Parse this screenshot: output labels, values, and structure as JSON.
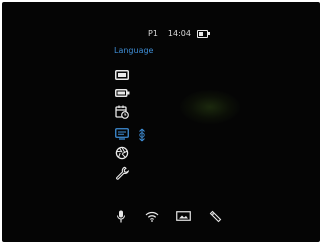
{
  "status": {
    "profile": "P1",
    "time": "14:04",
    "battery_level": 0.5
  },
  "menu": {
    "title": "Language",
    "items": [
      {
        "icon": "display-brightness-icon",
        "selected": false
      },
      {
        "icon": "battery-icon",
        "selected": false
      },
      {
        "icon": "calendar-clock-icon",
        "selected": false
      },
      {
        "icon": "language-icon",
        "selected": true
      },
      {
        "icon": "aperture-icon",
        "selected": false
      },
      {
        "icon": "wrench-icon",
        "selected": false
      }
    ],
    "selected_sub_icon": "globe-icon"
  },
  "bottom_bar": {
    "tabs": [
      {
        "icon": "microphone-icon"
      },
      {
        "icon": "wifi-icon"
      },
      {
        "icon": "image-icon"
      },
      {
        "icon": "tag-icon"
      }
    ]
  },
  "colors": {
    "background": "#050505",
    "accent": "#3f8ed6",
    "icon": "#e8e8e8",
    "text": "#d8d8d8"
  }
}
